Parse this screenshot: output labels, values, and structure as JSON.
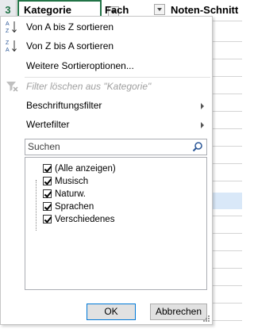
{
  "header": {
    "row_number": "3",
    "col_kategorie": "Kategorie",
    "col_fach": "Fach",
    "col_noten": "Noten-Schnitt"
  },
  "menu": {
    "sort_az": "Von A bis Z sortieren",
    "sort_za": "Von Z bis A sortieren",
    "more_sort": "Weitere Sortieroptionen...",
    "clear_filter": "Filter löschen aus \"Kategorie\"",
    "label_filter": "Beschriftungsfilter",
    "value_filter": "Wertefilter",
    "search_placeholder": "Suchen",
    "items": [
      {
        "label": "(Alle anzeigen)",
        "checked": true
      },
      {
        "label": "Musisch",
        "checked": true
      },
      {
        "label": "Naturw.",
        "checked": true
      },
      {
        "label": "Sprachen",
        "checked": true
      },
      {
        "label": "Verschiedenes",
        "checked": true
      }
    ],
    "ok": "OK",
    "cancel": "Abbrechen"
  },
  "colors": {
    "accent": "#217346",
    "ok_border": "#0078d7",
    "sort_icon_blue": "#2b5797"
  },
  "icons": [
    "sort-az-icon",
    "sort-za-icon",
    "clear-filter-icon",
    "magnifier-icon",
    "submenu-arrow-icon",
    "resize-grip-icon"
  ]
}
